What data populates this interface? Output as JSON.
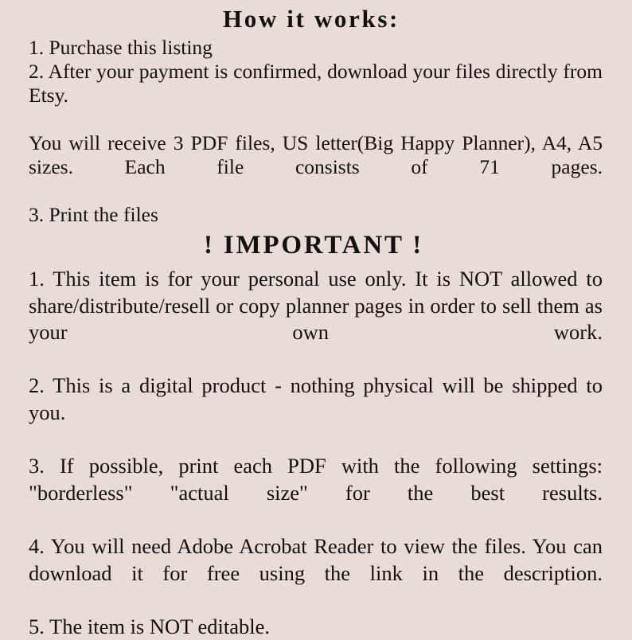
{
  "document": {
    "background_color": "#e9dcd6",
    "text_color": "#14100e",
    "sections": [
      {
        "id": "how-it-works",
        "heading": "How it works:",
        "paragraphs": [
          "1. Purchase this listing",
          "2. After your payment is confirmed, download your files directly from Etsy.",
          "You will receive 3 PDF files, US letter(Big Happy Planner), A4, A5 sizes. Each file consists of 71 pages.",
          "3. Print the files"
        ]
      },
      {
        "id": "important",
        "heading": "! IMPORTANT !",
        "paragraphs": [
          "1. This item is for your personal use only. It is NOT allowed to share/distribute/resell or copy planner pages in order to sell them as your own work.",
          "2. This is a digital product - nothing physical will be shipped to you.",
          "3. If possible, print each PDF with the following settings: \"borderless\" \"actual size\" for the best results.",
          "4. You will need Adobe Acrobat Reader to view the files. You can download it for free using the link in the description.",
          "5. The item is NOT editable."
        ]
      }
    ]
  }
}
